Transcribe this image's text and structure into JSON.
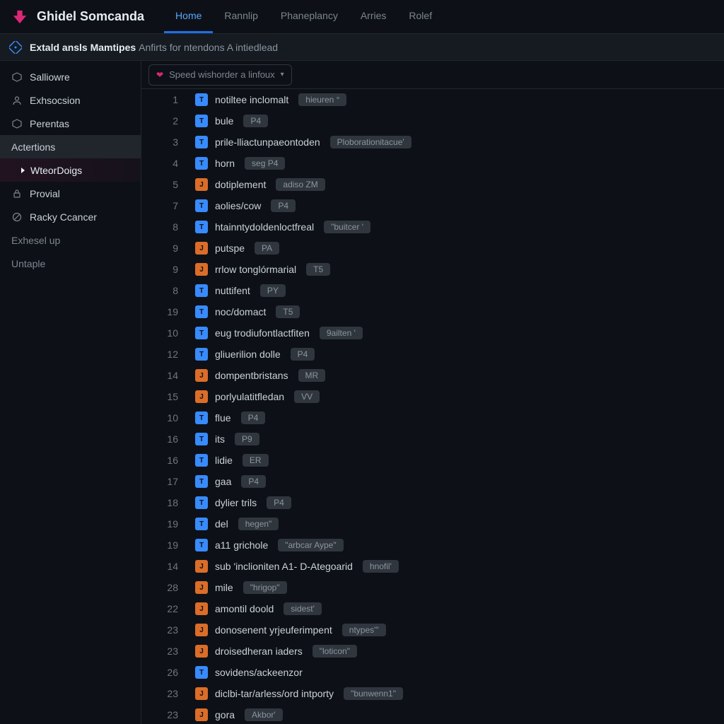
{
  "header": {
    "title": "Ghidel Somcanda",
    "tabs": [
      {
        "label": "Home",
        "active": true
      },
      {
        "label": "Rannlip"
      },
      {
        "label": "Phaneplancy"
      },
      {
        "label": "Arries"
      },
      {
        "label": "Rolef"
      }
    ]
  },
  "notice": {
    "strong": "Extald ansls Mamtipes",
    "rest": "Anfirts for ntendons A intiedlead"
  },
  "sidebar": {
    "items": [
      {
        "icon": "hexagon",
        "label": "Salliowre"
      },
      {
        "icon": "user",
        "label": "Exhsocsion"
      },
      {
        "icon": "hexagon",
        "label": "Perentas"
      },
      {
        "label": "Actertions",
        "variant": "selected"
      },
      {
        "label": "WteorDoigs",
        "variant": "sub"
      },
      {
        "icon": "lock",
        "label": "Provial"
      },
      {
        "icon": "stop",
        "label": "Racky Ccancer"
      },
      {
        "label": "Exhesel up",
        "variant": "plain"
      },
      {
        "label": "Untaple",
        "variant": "plain"
      }
    ]
  },
  "speedbar": {
    "text": "Speed wishorder a linfoux"
  },
  "files": [
    {
      "n": "1",
      "c": "blue",
      "name": "notiltee inclomalt",
      "badge": "hieuren °"
    },
    {
      "n": "2",
      "c": "blue",
      "name": "bule",
      "badge": "P4"
    },
    {
      "n": "3",
      "c": "blue",
      "name": "prile-lliactunpaeontoden",
      "badge": "Ploborationitacue'"
    },
    {
      "n": "4",
      "c": "blue",
      "name": "horn",
      "badge": "seg   P4"
    },
    {
      "n": "5",
      "c": "orange",
      "name": "dotiplement",
      "badge": "adiso   ZM"
    },
    {
      "n": "7",
      "c": "blue",
      "name": "aolies/cow",
      "badge": "P4"
    },
    {
      "n": "8",
      "c": "blue",
      "name": "htainntydoldenloctfreal",
      "badge": "\"buitcer '"
    },
    {
      "n": "9",
      "c": "orange",
      "name": "putspe",
      "badge": "PA"
    },
    {
      "n": "9",
      "c": "orange",
      "name": "rrlow tonglórmarial",
      "badge": "T5"
    },
    {
      "n": "8",
      "c": "blue",
      "name": "nuttifent",
      "badge": "PY"
    },
    {
      "n": "19",
      "c": "blue",
      "name": "noc/domact",
      "badge": "T5"
    },
    {
      "n": "10",
      "c": "blue",
      "name": "eug trodiufontlactfiten",
      "badge": "9ailten '"
    },
    {
      "n": "12",
      "c": "blue",
      "name": "gliuerilion dolle",
      "badge": "P4"
    },
    {
      "n": "14",
      "c": "orange",
      "name": "dompentbristans",
      "badge": "MR"
    },
    {
      "n": "15",
      "c": "orange",
      "name": "porlyulatitfledan",
      "badge": "VV"
    },
    {
      "n": "10",
      "c": "blue",
      "name": "flue",
      "badge": "P4"
    },
    {
      "n": "16",
      "c": "blue",
      "name": "its",
      "badge": "P9"
    },
    {
      "n": "16",
      "c": "blue",
      "name": "lidie",
      "badge": "ER"
    },
    {
      "n": "17",
      "c": "blue",
      "name": "gaa",
      "badge": "P4"
    },
    {
      "n": "18",
      "c": "blue",
      "name": "dylier trils",
      "badge": "P4"
    },
    {
      "n": "19",
      "c": "blue",
      "name": "del",
      "badge": "hegen\""
    },
    {
      "n": "19",
      "c": "blue",
      "name": "a11 grichole",
      "badge": "\"arbcar Aype\""
    },
    {
      "n": "14",
      "c": "orange",
      "name": "sub 'inclioniten A1- D-Ategoarid",
      "badge": "hnofil'"
    },
    {
      "n": "28",
      "c": "orange",
      "name": "mile",
      "badge": "\"hrigop\""
    },
    {
      "n": "22",
      "c": "orange",
      "name": "amontil doold",
      "badge": "sidest'"
    },
    {
      "n": "23",
      "c": "orange",
      "name": "donosenent yrjeuferimpent",
      "badge": "ntypes\"'"
    },
    {
      "n": "23",
      "c": "orange",
      "name": "droisedheran    iaders",
      "badge": "\"loticon\""
    },
    {
      "n": "26",
      "c": "blue",
      "name": "sovidens/ackeenzor",
      "badge": ""
    },
    {
      "n": "23",
      "c": "orange",
      "name": "diclbi-tar/arless/ord intporty",
      "badge": "\"bunwenn1\""
    },
    {
      "n": "23",
      "c": "orange",
      "name": "gora",
      "badge": "Akbor'"
    }
  ]
}
